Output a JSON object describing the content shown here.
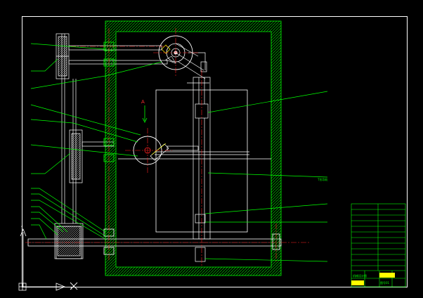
{
  "drawing": {
    "view_label": "A",
    "callout_text": "T形导轨",
    "title_block_name": "机械设计图",
    "title_block_number": "图号01"
  },
  "ucs": {
    "y_label": "Y",
    "x_label": "X"
  },
  "colors": {
    "background": "#000000",
    "outline": "#ffffff",
    "leaders": "#00ff00",
    "hatch": "#00cc00",
    "centerlines": "#ff2020",
    "highlight": "#ffff00"
  }
}
